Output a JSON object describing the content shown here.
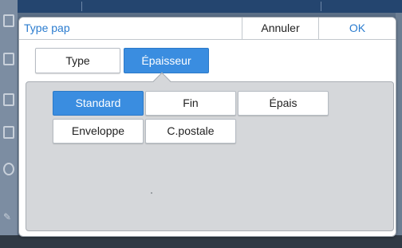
{
  "dialog": {
    "title": "Type pap",
    "cancel_label": "Annuler",
    "ok_label": "OK"
  },
  "tabs": [
    {
      "label": "Type",
      "selected": false
    },
    {
      "label": "Épaisseur",
      "selected": true
    }
  ],
  "options": [
    {
      "label": "Standard",
      "selected": true
    },
    {
      "label": "Fin",
      "selected": false
    },
    {
      "label": "Épais",
      "selected": false
    },
    {
      "label": "Enveloppe",
      "selected": false
    },
    {
      "label": "C.postale",
      "selected": false
    }
  ],
  "colors": {
    "accent": "#3a8de0",
    "title_text": "#2b7ccf",
    "panel_bg": "#d5d7da",
    "backdrop": "#5a6e86"
  },
  "icons": [
    "document-icon",
    "checkmark-icon",
    "signature-icon"
  ]
}
